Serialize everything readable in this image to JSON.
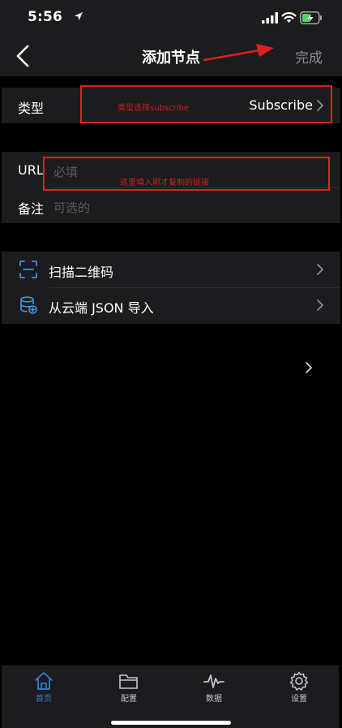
{
  "status_bar": {
    "time": "5:56"
  },
  "nav": {
    "title": "添加节点",
    "done_label": "完成"
  },
  "form": {
    "type_label": "类型",
    "type_value": "Subscribe",
    "type_annotation": "类型选择subscribe",
    "url_label": "URL",
    "url_placeholder": "必填",
    "url_annotation": "这里填入刚才复制的链接",
    "note_label": "备注",
    "note_placeholder": "可选的"
  },
  "actions": [
    {
      "label": "扫描二维码",
      "icon": "qr-scan-icon"
    },
    {
      "label": "从云端 JSON 导入",
      "icon": "cloud-database-import-icon"
    }
  ],
  "tabs": [
    {
      "label": "首页",
      "icon": "home-icon",
      "active": true
    },
    {
      "label": "配置",
      "icon": "folder-icon",
      "active": false
    },
    {
      "label": "数据",
      "icon": "activity-wave-icon",
      "active": false
    },
    {
      "label": "设置",
      "icon": "gear-icon",
      "active": false
    }
  ],
  "colors": {
    "annotation_red": "#e02020",
    "active_tab_blue": "#3a7bd5",
    "surface": "#1c1c1e",
    "background": "#000000"
  }
}
